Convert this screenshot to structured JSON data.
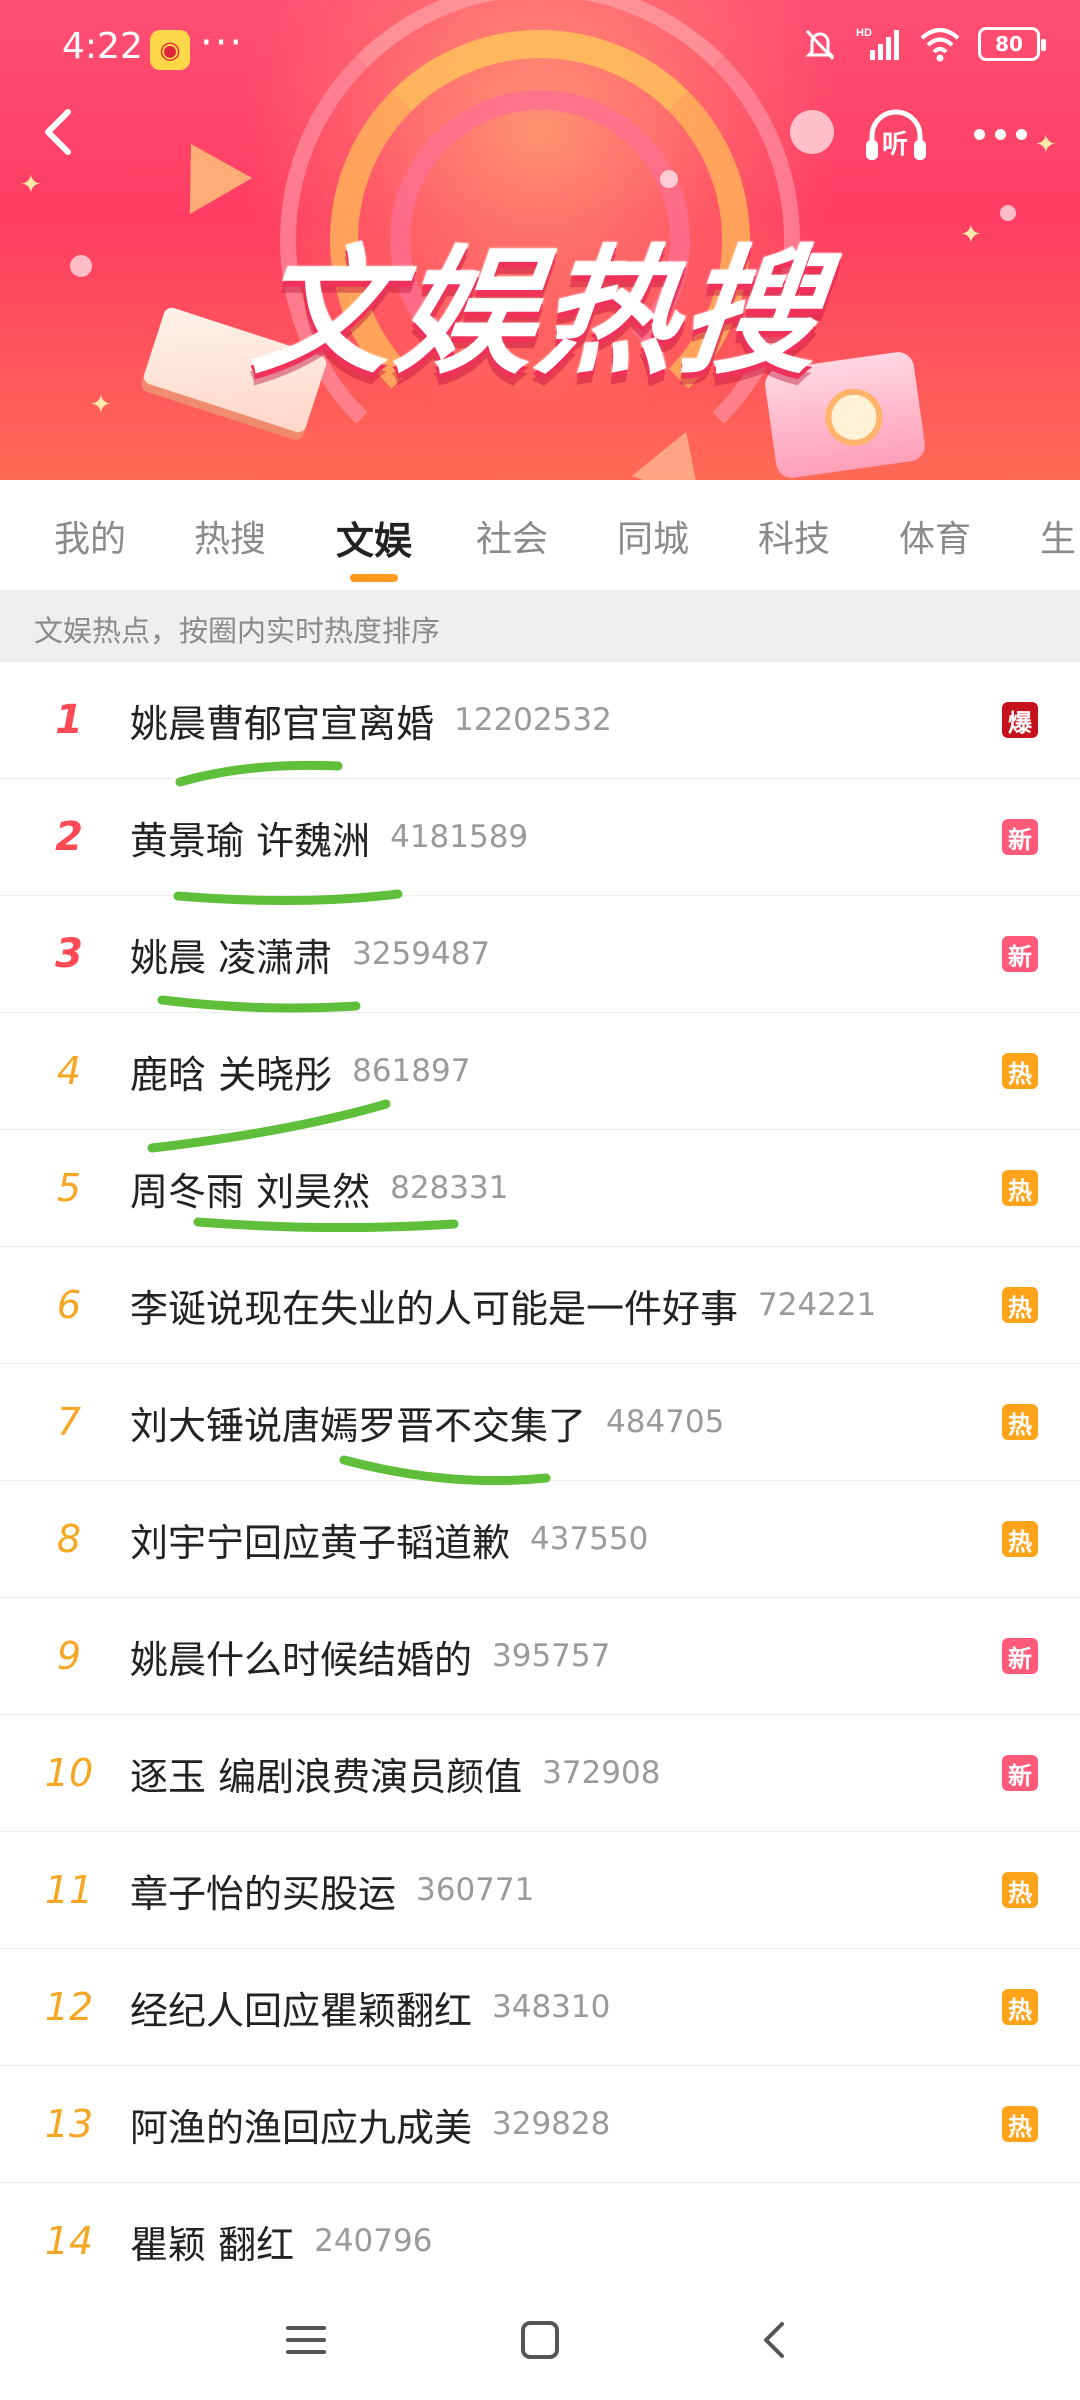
{
  "status_bar": {
    "time": "4:22",
    "app_icon": "weibo-icon",
    "battery": "80",
    "icons": [
      "bell-muted-icon",
      "hd-signal-icon",
      "wifi-icon",
      "battery-icon"
    ]
  },
  "banner": {
    "title": "文娱热搜",
    "listen_label": "听"
  },
  "tabs": [
    {
      "label": "我的",
      "active": false
    },
    {
      "label": "热搜",
      "active": false
    },
    {
      "label": "文娱",
      "active": true
    },
    {
      "label": "社会",
      "active": false
    },
    {
      "label": "同城",
      "active": false
    },
    {
      "label": "科技",
      "active": false
    },
    {
      "label": "体育",
      "active": false
    },
    {
      "label": "生",
      "active": false
    }
  ],
  "subtitle": "文娱热点，按圈内实时热度排序",
  "colors": {
    "banner_top": "#ff4f73",
    "accent_orange": "#ff9a1f",
    "rank_red": "#ff4a55",
    "rank_orange": "#f5a623",
    "badge_bao": "#c6121c",
    "badge_xin": "#ff5a7a",
    "badge_re": "#ffa31a",
    "marker_green": "#5fbf3a"
  },
  "list": [
    {
      "rank": "1",
      "title": "姚晨曹郁官宣离婚",
      "count": "12202532",
      "badge": "爆",
      "badge_type": "bao"
    },
    {
      "rank": "2",
      "title": "黄景瑜 许魏洲",
      "count": "4181589",
      "badge": "新",
      "badge_type": "xin"
    },
    {
      "rank": "3",
      "title": "姚晨 凌潇肃",
      "count": "3259487",
      "badge": "新",
      "badge_type": "xin"
    },
    {
      "rank": "4",
      "title": "鹿晗 关晓彤",
      "count": "861897",
      "badge": "热",
      "badge_type": "re"
    },
    {
      "rank": "5",
      "title": "周冬雨 刘昊然",
      "count": "828331",
      "badge": "热",
      "badge_type": "re"
    },
    {
      "rank": "6",
      "title": "李诞说现在失业的人可能是一件好事",
      "count": "724221",
      "badge": "热",
      "badge_type": "re"
    },
    {
      "rank": "7",
      "title": "刘大锤说唐嫣罗晋不交集了",
      "count": "484705",
      "badge": "热",
      "badge_type": "re"
    },
    {
      "rank": "8",
      "title": "刘宇宁回应黄子韬道歉",
      "count": "437550",
      "badge": "热",
      "badge_type": "re"
    },
    {
      "rank": "9",
      "title": "姚晨什么时候结婚的",
      "count": "395757",
      "badge": "新",
      "badge_type": "xin"
    },
    {
      "rank": "10",
      "title": "逐玉 编剧浪费演员颜值",
      "count": "372908",
      "badge": "新",
      "badge_type": "xin"
    },
    {
      "rank": "11",
      "title": "章子怡的买股运",
      "count": "360771",
      "badge": "热",
      "badge_type": "re"
    },
    {
      "rank": "12",
      "title": "经纪人回应瞿颖翻红",
      "count": "348310",
      "badge": "热",
      "badge_type": "re"
    },
    {
      "rank": "13",
      "title": "阿渔的渔回应九成美",
      "count": "329828",
      "badge": "热",
      "badge_type": "re"
    },
    {
      "rank": "14",
      "title": "瞿颖 翻红",
      "count": "240796",
      "badge": "",
      "badge_type": ""
    }
  ]
}
